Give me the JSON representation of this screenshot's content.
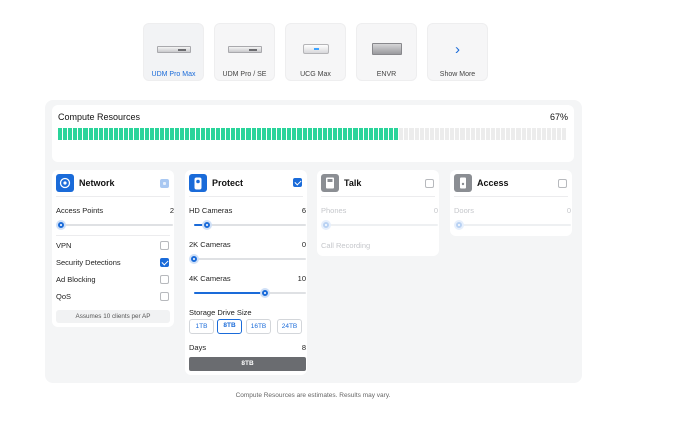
{
  "devices": [
    {
      "label": "UDM Pro Max",
      "icon": "udm-pro-max-device-icon",
      "selected": true
    },
    {
      "label": "UDM Pro / SE",
      "icon": "udm-pro-se-device-icon",
      "selected": false
    },
    {
      "label": "UCG Max",
      "icon": "ucg-max-device-icon",
      "selected": false
    },
    {
      "label": "ENVR",
      "icon": "envr-device-icon",
      "selected": false
    },
    {
      "label": "Show More",
      "icon": "chevron-right-icon",
      "selected": false
    }
  ],
  "compute": {
    "title": "Compute Resources",
    "percent_label": "67%",
    "fill_fraction": 0.67,
    "fill_color": "#2ad49a",
    "empty_color": "#ececec"
  },
  "network": {
    "title": "Network",
    "icon": "network-icon",
    "access_points": {
      "label": "Access Points",
      "value": "2",
      "fraction": 0.0
    },
    "options": [
      {
        "label": "VPN",
        "checked": false
      },
      {
        "label": "Security Detections",
        "checked": true
      },
      {
        "label": "Ad Blocking",
        "checked": false
      },
      {
        "label": "QoS",
        "checked": false
      }
    ],
    "note": "Assumes 10 clients per AP"
  },
  "protect": {
    "title": "Protect",
    "icon": "camera-icon",
    "enabled": true,
    "hd": {
      "label": "HD Cameras",
      "value": "6",
      "fraction": 0.16
    },
    "twok": {
      "label": "2K Cameras",
      "value": "0",
      "fraction": 0.0
    },
    "fourk": {
      "label": "4K Cameras",
      "value": "10",
      "fraction": 0.65
    },
    "storage": {
      "label": "Storage Drive Size",
      "options": [
        "1TB",
        "8TB",
        "16TB",
        "24TB"
      ],
      "selected": "8TB"
    },
    "days": {
      "label": "Days",
      "value": "8"
    },
    "summary": "8TB"
  },
  "talk": {
    "title": "Talk",
    "icon": "phone-icon",
    "enabled": false,
    "phones": {
      "label": "Phones",
      "value": "0"
    },
    "call_recording": "Call Recording"
  },
  "access": {
    "title": "Access",
    "icon": "door-icon",
    "enabled": false,
    "doors": {
      "label": "Doors",
      "value": "0"
    }
  },
  "footnote": "Compute Resources are estimates. Results may vary."
}
